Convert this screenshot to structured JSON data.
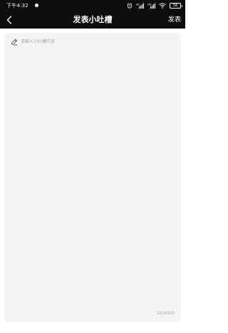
{
  "status_bar": {
    "time": "下午4:32",
    "battery": "58"
  },
  "nav": {
    "title": "发表小吐槽",
    "publish_label": "发表",
    "back_icon": "chevron-left-icon"
  },
  "editor": {
    "placeholder": "请输入小吐槽内容",
    "value": "",
    "counter": "10/4000",
    "pen_icon": "pen-icon"
  },
  "colors": {
    "header_bg": "#0d0d0d",
    "card_bg": "#f6f3f5",
    "placeholder_text": "#a9a6a8"
  }
}
